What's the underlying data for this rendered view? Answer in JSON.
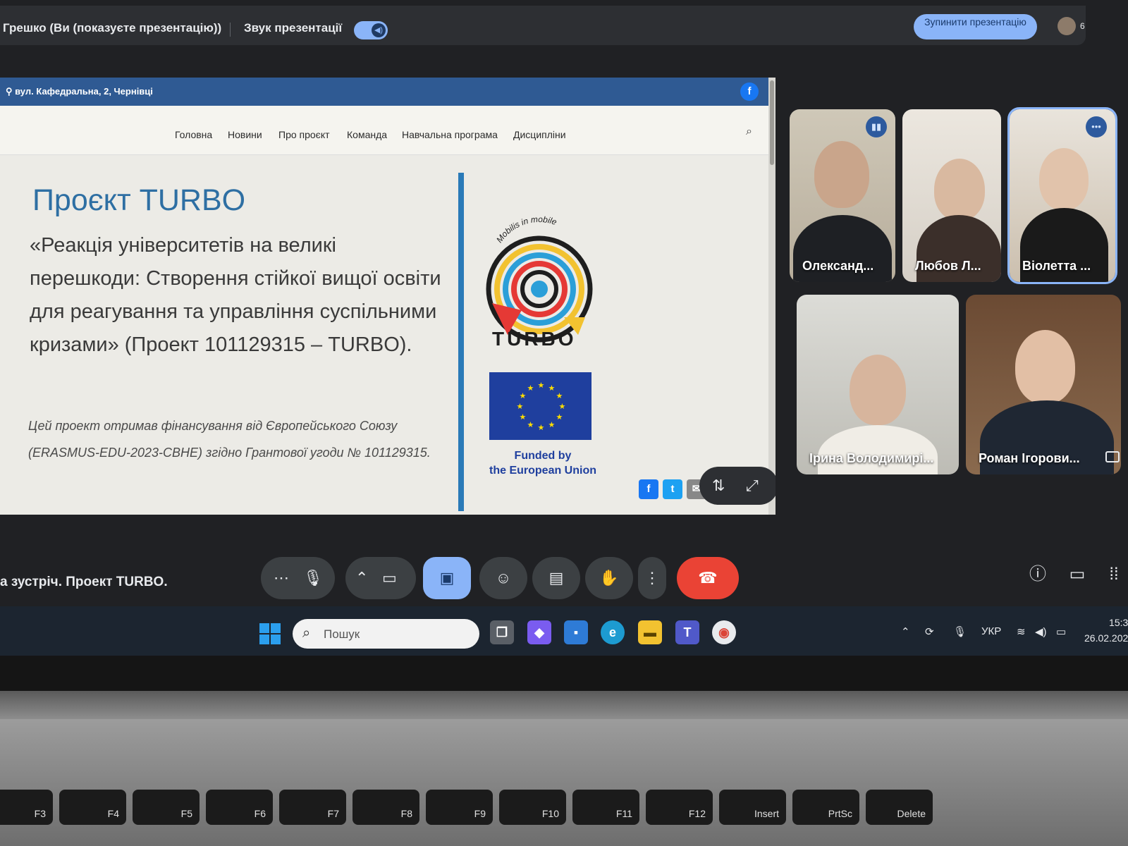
{
  "meet": {
    "presenter_label": "Грешко (Ви (показуєте презентацію))",
    "sound_label": "Звук презентації",
    "stop_button": "Зупинити презентацію",
    "participant_count": "6",
    "meeting_title": "а зустріч. Проект TURBO."
  },
  "site": {
    "address": "вул. Кафедральна, 2, Чернівці",
    "nav": [
      "Головна",
      "Новини",
      "Про проєкт",
      "Команда",
      "Навчальна програма",
      "Дисципліни"
    ],
    "title": "Проєкт TURBO",
    "description": "«Реакція університетів на великі перешкоди: Створення стійкої вищої освіти для реагування та управління суспільними кризами» (Проект 101129315 – TURBO).",
    "funding_note": "Цей проект отримав фінансування від Європейського Союзу (ERASMUS-EDU-2023-CBHE) згідно Грантової угоди № 101129315.",
    "logo_motto": "Mobilis in mobile",
    "logo_word": "TURBO",
    "funded_line1": "Funded by",
    "funded_line2": "the European Union"
  },
  "participants": [
    {
      "name": "Олександ..."
    },
    {
      "name": "Любов Л..."
    },
    {
      "name": "Віолетта ..."
    },
    {
      "name": "Ірина Володимирі..."
    },
    {
      "name": "Роман Ігорови..."
    }
  ],
  "taskbar": {
    "search_placeholder": "Пошук",
    "language": "УКР",
    "time": "15:3",
    "date": "26.02.202"
  },
  "keyboard": [
    "F3",
    "F4",
    "F5",
    "F6",
    "F7",
    "F8",
    "F9",
    "F10",
    "F11",
    "F12",
    "Insert",
    "PrtSc",
    "Delete"
  ],
  "colors": {
    "accent": "#8ab4f8",
    "leave": "#ea4335",
    "site_header": "#2f5a93",
    "title_blue": "#2e6fa3"
  }
}
